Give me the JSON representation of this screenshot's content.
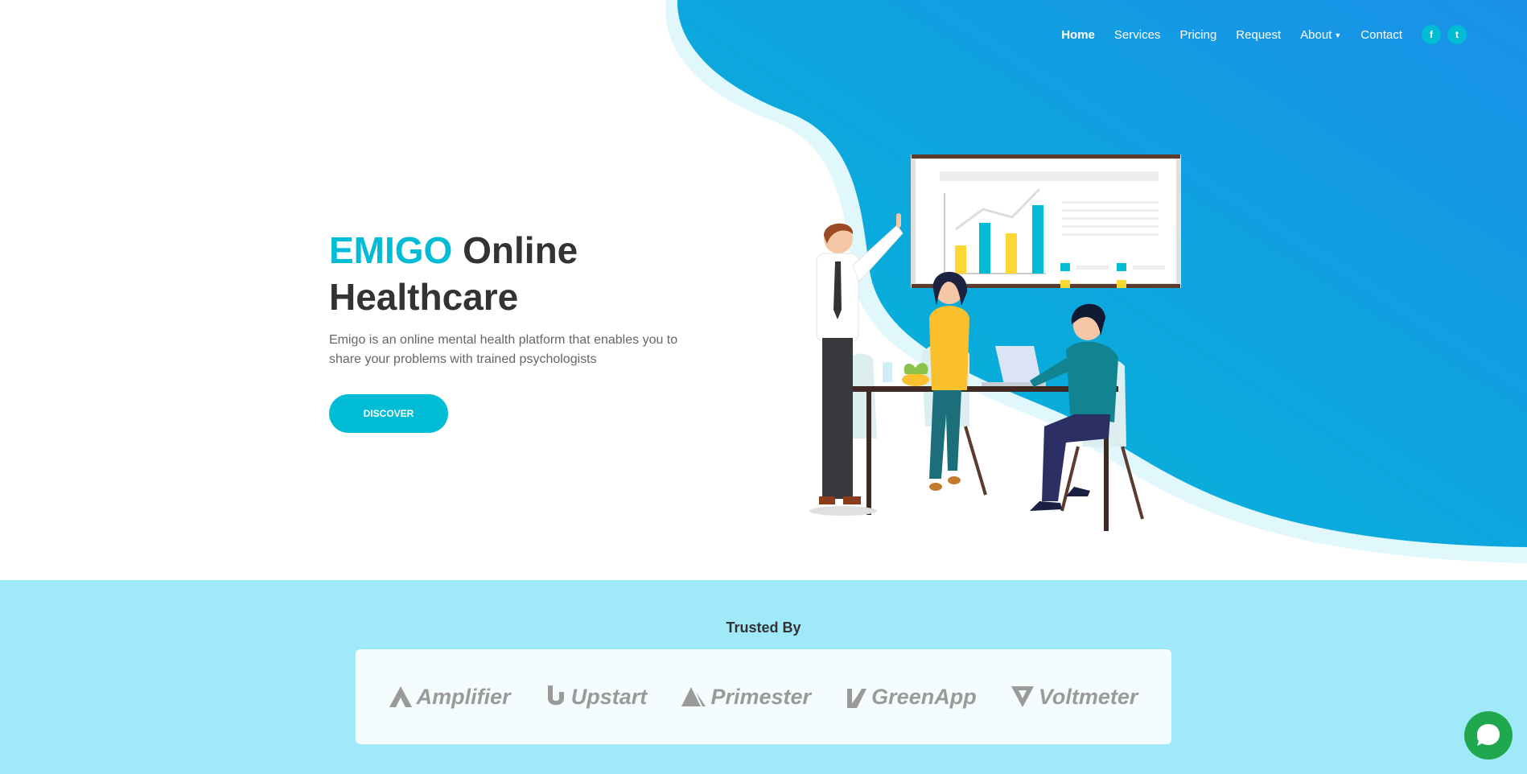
{
  "nav": {
    "items": [
      {
        "label": "Home",
        "active": true
      },
      {
        "label": "Services"
      },
      {
        "label": "Pricing"
      },
      {
        "label": "Request"
      },
      {
        "label": "About",
        "dropdown": true
      },
      {
        "label": "Contact"
      }
    ],
    "social": [
      {
        "icon": "facebook-icon",
        "glyph": "f"
      },
      {
        "icon": "twitter-icon",
        "glyph": "t"
      }
    ]
  },
  "hero": {
    "title_brand": "EMIGO",
    "title_rest": "Online Healthcare",
    "subtitle": "Emigo is an online mental health platform that enables you to share your problems with trained psychologists",
    "cta_label": "DISCOVER"
  },
  "trusted": {
    "title": "Trusted By",
    "logos": [
      "Amplifier",
      "Upstart",
      "Primester",
      "GreenApp",
      "Voltmeter"
    ]
  },
  "colors": {
    "accent": "#00bcd4",
    "trusted_bg": "#a0e9f9",
    "chat": "#1fa84e"
  }
}
